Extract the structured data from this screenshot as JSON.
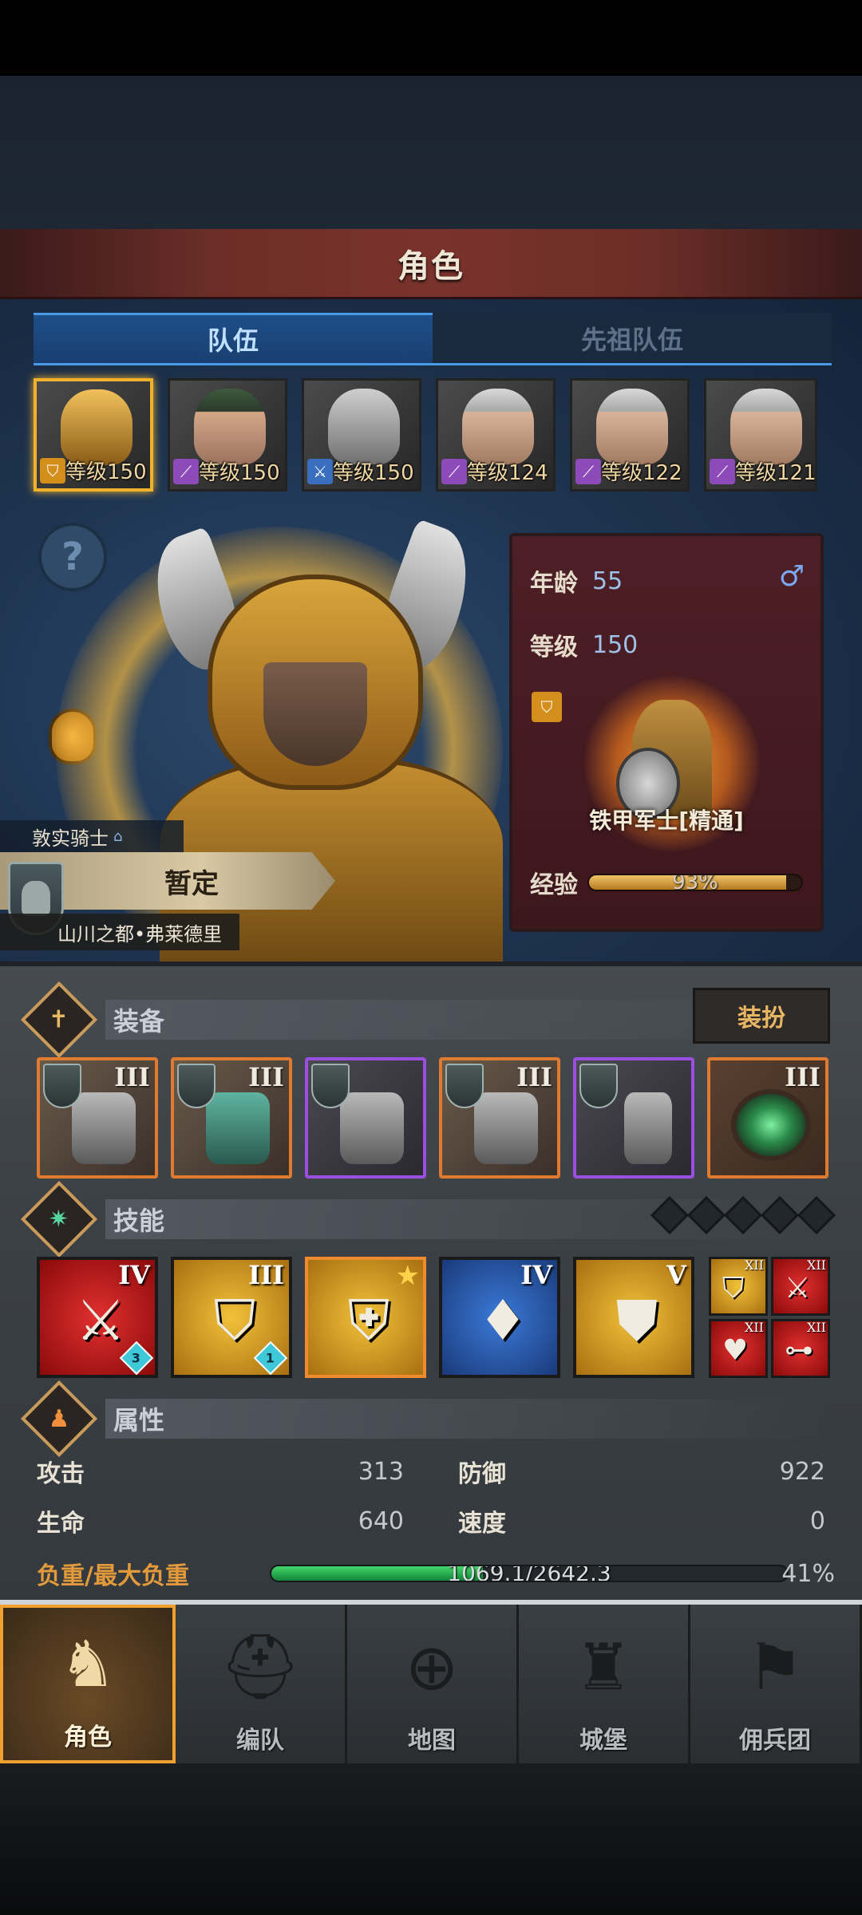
{
  "header": {
    "title": "角色"
  },
  "tabs": [
    {
      "label": "队伍",
      "active": true
    },
    {
      "label": "先祖队伍",
      "active": false
    }
  ],
  "team": [
    {
      "level_label": "等级150",
      "class_color": "gold",
      "selected": true
    },
    {
      "level_label": "等级150",
      "class_color": "purple",
      "selected": false
    },
    {
      "level_label": "等级150",
      "class_color": "blue",
      "selected": false
    },
    {
      "level_label": "等级124",
      "class_color": "purple",
      "selected": false
    },
    {
      "level_label": "等级122",
      "class_color": "purple",
      "selected": false
    },
    {
      "level_label": "等级121",
      "class_color": "purple",
      "selected": false
    }
  ],
  "hero": {
    "title_label": "敦实骑士",
    "name": "暂定",
    "location": "山川之都•弗莱德里"
  },
  "info": {
    "age_label": "年龄",
    "age": "55",
    "level_label": "等级",
    "level": "150",
    "gender_symbol": "♂",
    "class_name": "铁甲军士[精通]",
    "exp_label": "经验",
    "exp_pct": 93,
    "exp_text": "93%"
  },
  "equipment": {
    "title": "装备",
    "dress_button": "装扮",
    "items": [
      {
        "tier": "III",
        "rarity": "orange",
        "icon": "warhammer-icon"
      },
      {
        "tier": "III",
        "rarity": "orange",
        "icon": "tower-shield-icon"
      },
      {
        "tier": "",
        "rarity": "purple",
        "icon": "helmet-icon"
      },
      {
        "tier": "III",
        "rarity": "orange",
        "icon": "chest-armor-icon"
      },
      {
        "tier": "",
        "rarity": "purple",
        "icon": "greaves-icon"
      },
      {
        "tier": "III",
        "rarity": "orange",
        "icon": "ring-icon"
      }
    ]
  },
  "skills": {
    "title": "技能",
    "items": [
      {
        "tier": "IV",
        "color": "red",
        "gem": "3"
      },
      {
        "tier": "III",
        "color": "gold",
        "gem": "1"
      },
      {
        "tier": "",
        "color": "gold",
        "gem": ""
      },
      {
        "tier": "IV",
        "color": "blue",
        "gem": ""
      },
      {
        "tier": "V",
        "color": "gold",
        "gem": ""
      }
    ],
    "passives": [
      {
        "tier": "XII",
        "color": "gold"
      },
      {
        "tier": "XII",
        "color": "red"
      },
      {
        "tier": "XII",
        "color": "red"
      },
      {
        "tier": "XII",
        "color": "red"
      }
    ]
  },
  "attributes": {
    "title": "属性",
    "attack_label": "攻击",
    "attack": "313",
    "defense_label": "防御",
    "defense": "922",
    "hp_label": "生命",
    "hp": "640",
    "speed_label": "速度",
    "speed": "0",
    "load_label": "负重/最大负重",
    "load_text": "1069.1/2642.3",
    "load_pct": 41,
    "load_pct_text": "41%"
  },
  "nav": [
    {
      "label": "角色",
      "icon": "knight-icon",
      "active": true
    },
    {
      "label": "编队",
      "icon": "helmet-squad-icon",
      "active": false
    },
    {
      "label": "地图",
      "icon": "compass-map-icon",
      "active": false
    },
    {
      "label": "城堡",
      "icon": "castle-icon",
      "active": false
    },
    {
      "label": "佣兵团",
      "icon": "banner-sword-icon",
      "active": false
    }
  ],
  "colors": {
    "accent_gold": "#f0b12d",
    "tab_blue": "#4a9ae8",
    "load_green": "#43d66a",
    "rarity_orange": "#e07a2e",
    "rarity_purple": "#9b4fe0"
  }
}
